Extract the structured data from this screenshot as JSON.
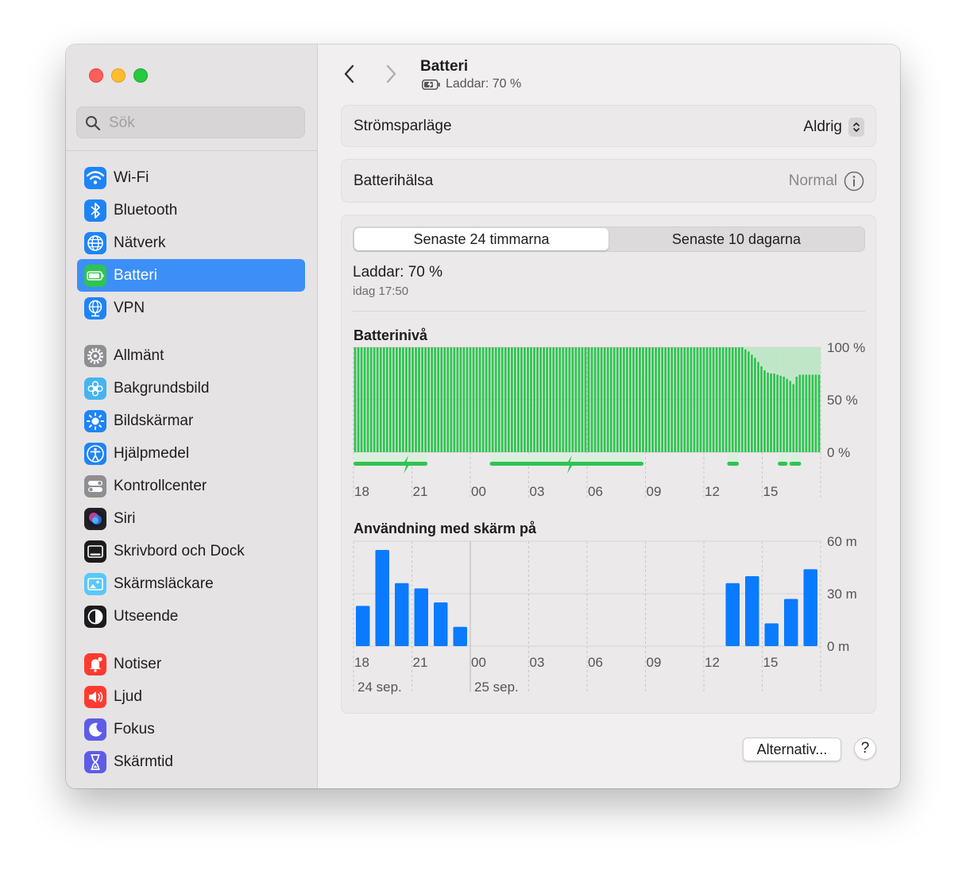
{
  "window": {
    "controls": [
      "close",
      "minimize",
      "zoom"
    ]
  },
  "search": {
    "placeholder": "Sök",
    "value": ""
  },
  "sidebar": {
    "groups": [
      [
        {
          "label": "Wi-Fi",
          "icon": "wifi-icon",
          "color": "#1e84f5",
          "active": false
        },
        {
          "label": "Bluetooth",
          "icon": "bluetooth-icon",
          "color": "#1e84f5",
          "active": false
        },
        {
          "label": "Nätverk",
          "icon": "globe-icon",
          "color": "#1e84f5",
          "active": false
        },
        {
          "label": "Batteri",
          "icon": "battery-icon",
          "color": "#2fc451",
          "active": true
        },
        {
          "label": "VPN",
          "icon": "vpn-globe-icon",
          "color": "#1e84f5",
          "active": false
        }
      ],
      [
        {
          "label": "Allmänt",
          "icon": "gear-icon",
          "color": "#8e8e93",
          "active": false
        },
        {
          "label": "Bakgrundsbild",
          "icon": "flower-icon",
          "color": "#45b4f0",
          "active": false
        },
        {
          "label": "Bildskärmar",
          "icon": "sun-icon",
          "color": "#1e84f5",
          "active": false
        },
        {
          "label": "Hjälpmedel",
          "icon": "accessibility-icon",
          "color": "#1e84f5",
          "active": false
        },
        {
          "label": "Kontrollcenter",
          "icon": "toggles-icon",
          "color": "#8e8e93",
          "active": false
        },
        {
          "label": "Siri",
          "icon": "siri-icon",
          "color": "#222222",
          "active": false
        },
        {
          "label": "Skrivbord och Dock",
          "icon": "dock-icon",
          "color": "#1c1c1e",
          "active": false
        },
        {
          "label": "Skärmsläckare",
          "icon": "screensaver-icon",
          "color": "#5ac8fa",
          "active": false
        },
        {
          "label": "Utseende",
          "icon": "appearance-icon",
          "color": "#1c1c1e",
          "active": false
        }
      ],
      [
        {
          "label": "Notiser",
          "icon": "bell-icon",
          "color": "#ff3b30",
          "active": false
        },
        {
          "label": "Ljud",
          "icon": "speaker-icon",
          "color": "#ff3b30",
          "active": false
        },
        {
          "label": "Fokus",
          "icon": "moon-icon",
          "color": "#5e5ce6",
          "active": false
        },
        {
          "label": "Skärmtid",
          "icon": "hourglass-icon",
          "color": "#5e5ce6",
          "active": false
        }
      ]
    ]
  },
  "header": {
    "title": "Batteri",
    "subtitle": "Laddar: 70 %"
  },
  "power_mode": {
    "label": "Strömsparläge",
    "value": "Aldrig"
  },
  "battery_health": {
    "label": "Batterihälsa",
    "value": "Normal"
  },
  "tabs": {
    "first": "Senaste 24 timmarna",
    "second": "Senaste 10 dagarna",
    "selected": 0
  },
  "status": {
    "text": "Laddar: 70 %",
    "time": "idag 17:50"
  },
  "colors": {
    "accent": "#3d8ff8",
    "battery_green": "#2fc451",
    "usage_blue": "#0a7aff"
  },
  "chart_data": [
    {
      "type": "bar",
      "title": "Batterinivå",
      "y_unit": "%",
      "ylim": [
        0,
        100
      ],
      "y_ticks": [
        "100 %",
        "50 %",
        "0 %"
      ],
      "x_ticks": [
        "18",
        "21",
        "00",
        "03",
        "06",
        "09",
        "12",
        "15"
      ],
      "values": [
        100,
        100,
        100,
        100,
        100,
        100,
        100,
        100,
        100,
        100,
        100,
        100,
        100,
        100,
        100,
        100,
        100,
        100,
        100,
        100,
        100,
        100,
        100,
        100,
        100,
        100,
        100,
        100,
        100,
        100,
        100,
        100,
        100,
        100,
        100,
        100,
        100,
        100,
        100,
        100,
        100,
        100,
        100,
        100,
        100,
        100,
        100,
        100,
        100,
        100,
        100,
        100,
        100,
        100,
        100,
        100,
        100,
        100,
        100,
        100,
        100,
        100,
        100,
        100,
        100,
        100,
        100,
        100,
        100,
        100,
        100,
        100,
        100,
        100,
        100,
        100,
        100,
        100,
        100,
        100,
        100,
        100,
        100,
        100,
        100,
        100,
        100,
        100,
        100,
        100,
        100,
        100,
        100,
        100,
        100,
        100,
        100,
        100,
        100,
        100,
        100,
        100,
        100,
        100,
        100,
        100,
        100,
        100,
        100,
        100,
        100,
        100,
        100,
        100,
        100,
        100,
        100,
        100,
        100,
        100,
        100,
        100,
        98,
        96,
        93,
        90,
        86,
        82,
        78,
        76,
        75,
        75,
        74,
        73,
        72,
        70,
        68,
        65,
        72,
        74,
        74,
        74,
        74,
        74,
        74,
        74
      ],
      "charging_segments": [
        [
          18.0,
          21.8
        ],
        [
          1.0,
          8.9
        ],
        [
          13.2,
          13.8
        ],
        [
          15.8,
          16.3
        ],
        [
          16.4,
          17.0
        ]
      ]
    },
    {
      "type": "bar",
      "title": "Användning med skärm på",
      "y_unit": "min",
      "ylim": [
        0,
        60
      ],
      "y_ticks": [
        "60 m",
        "30 m",
        "0 m"
      ],
      "x_ticks": [
        "18",
        "21",
        "00",
        "03",
        "06",
        "09",
        "12",
        "15"
      ],
      "date_labels": [
        "24 sep.",
        "25 sep."
      ],
      "values": [
        23,
        55,
        36,
        33,
        25,
        11,
        0,
        0,
        0,
        0,
        0,
        0,
        0,
        0,
        0,
        0,
        0,
        0,
        0,
        36,
        40,
        13,
        27,
        44
      ]
    }
  ],
  "footer": {
    "options_label": "Alternativ...",
    "help_label": "?"
  }
}
